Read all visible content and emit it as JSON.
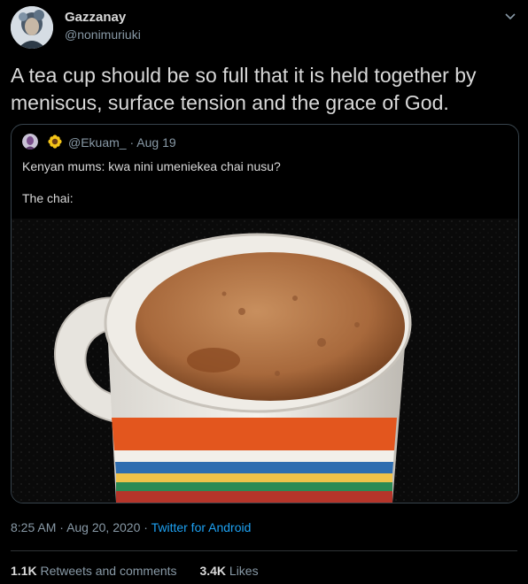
{
  "author": {
    "display_name": "Gazzanay",
    "handle": "@nonimuriuki"
  },
  "tweet": {
    "text": "A tea cup should be so full that it is held together by meniscus, surface tension and the grace of God."
  },
  "quoted": {
    "handle": "@Ekuam_",
    "separator": "·",
    "date": "Aug 19",
    "line1": "Kenyan mums: kwa nini umeniekea chai nusu?",
    "line2": "The chai:"
  },
  "meta": {
    "time": "8:25 AM",
    "date": "Aug 20, 2020",
    "separator": "·",
    "source": "Twitter for Android"
  },
  "stats": {
    "retweets_count": "1.1K",
    "retweets_label": "Retweets and comments",
    "likes_count": "3.4K",
    "likes_label": "Likes"
  },
  "colors": {
    "background": "#000000",
    "text": "#d9d9d9",
    "muted": "#8899a6",
    "link": "#1da1f2",
    "border": "#38444d"
  },
  "icons": [
    "chevron-down-icon",
    "sunflower-emoji-icon"
  ]
}
